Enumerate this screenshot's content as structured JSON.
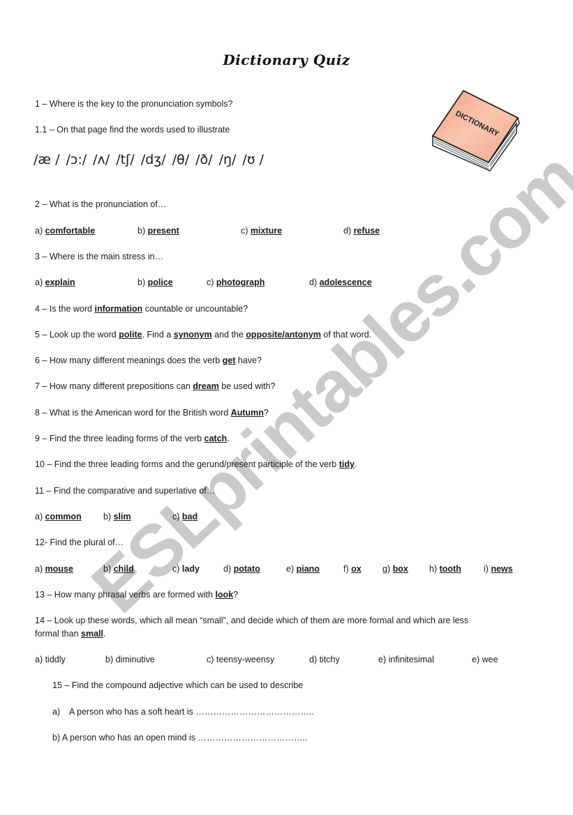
{
  "title": "Dictionary Quiz",
  "watermark": "ESLprintables.com",
  "book_image": {
    "label": "DICTIONARY",
    "icon": "dictionary-book-icon"
  },
  "q1": {
    "text": "1 – Where is the key to the pronunciation symbols?"
  },
  "q1_1": {
    "text": "1.1  – On that page find the words used to illustrate"
  },
  "ipa_symbols": [
    "/æ /",
    "/ɔ:/",
    "/ʌ/",
    "/tʃ/",
    "/dʒ/",
    "/θ/",
    "/ð/",
    "/ŋ/",
    "/ʊ /"
  ],
  "q2": {
    "text": "2 – What is the pronunciation of…",
    "options": [
      {
        "letter": "a)",
        "word": "comfortable"
      },
      {
        "letter": "b)",
        "word": "present"
      },
      {
        "letter": "c)",
        "word": "mixture"
      },
      {
        "letter": "d)",
        "word": "refuse"
      }
    ]
  },
  "q3": {
    "text": "3 – Where is the main stress in…",
    "options": [
      {
        "letter": "a)",
        "word": "explain"
      },
      {
        "letter": "b)",
        "word": "police"
      },
      {
        "letter": "c)",
        "word": "photograph"
      },
      {
        "letter": "d)",
        "word": "adolescence"
      }
    ]
  },
  "q4": {
    "pre": "4 – Is the word ",
    "kw": "information",
    "post": " countable or uncountable?"
  },
  "q5": {
    "pre": "5 – Look up the word ",
    "kw1": "polite",
    "mid1": ". Find a ",
    "kw2": "synonym",
    "mid2": " and the ",
    "kw3": "opposite/antonym",
    "post": " of that word."
  },
  "q6": {
    "pre": "6 – How many different meanings does the verb ",
    "kw": "get",
    "post": " have?"
  },
  "q7": {
    "pre": "7 – How many different prepositions can ",
    "kw": "dream",
    "post": " be used with?"
  },
  "q8": {
    "pre": "8 – What is the American word for the British word ",
    "kw": "Autumn",
    "post": "?"
  },
  "q9": {
    "pre": "9 – Find the three leading forms of the verb ",
    "kw": "catch",
    "post": "."
  },
  "q10": {
    "pre": "10 – Find the three leading forms and the gerund/present participle of the verb ",
    "kw": "tidy",
    "post": "."
  },
  "q11": {
    "text": "11 – Find the comparative and superlative of…",
    "options": [
      {
        "letter": "a)",
        "word": "common"
      },
      {
        "letter": "b)",
        "word": "slim"
      },
      {
        "letter": "c)",
        "word": "bad"
      }
    ]
  },
  "q12": {
    "text": "12- Find the plural of…",
    "options": [
      {
        "letter": "a)",
        "word": "mouse"
      },
      {
        "letter": "b)",
        "word": "child"
      },
      {
        "letter": "c)",
        "word": "lady"
      },
      {
        "letter": "d)",
        "word": "potato"
      },
      {
        "letter": "e)",
        "word": "piano"
      },
      {
        "letter": "f)",
        "word": "ox"
      },
      {
        "letter": "g)",
        "word": "box"
      },
      {
        "letter": "h)",
        "word": "tooth"
      },
      {
        "letter": "i)",
        "word": "news"
      }
    ]
  },
  "q13": {
    "pre": "13 – How many phrasal verbs are formed with ",
    "kw": "look",
    "post": "?"
  },
  "q14": {
    "line1": "14 – Look up these words, which all mean “small”, and decide which of them are more formal and which are less",
    "line2_pre": "formal than ",
    "line2_kw": "small",
    "line2_post": ".",
    "options": [
      "a) tiddly",
      "b) diminutive",
      "c) teensy-weensy",
      "d) titchy",
      "e) infinitesimal",
      "e) wee"
    ]
  },
  "q15": {
    "text": "15   – Find the compound adjective which can be used to describe",
    "a_letter": "a)",
    "a_text": "A person who has a soft heart is …………………………………..",
    "b_text": "b) A person who has an open mind is ……………………………….."
  }
}
